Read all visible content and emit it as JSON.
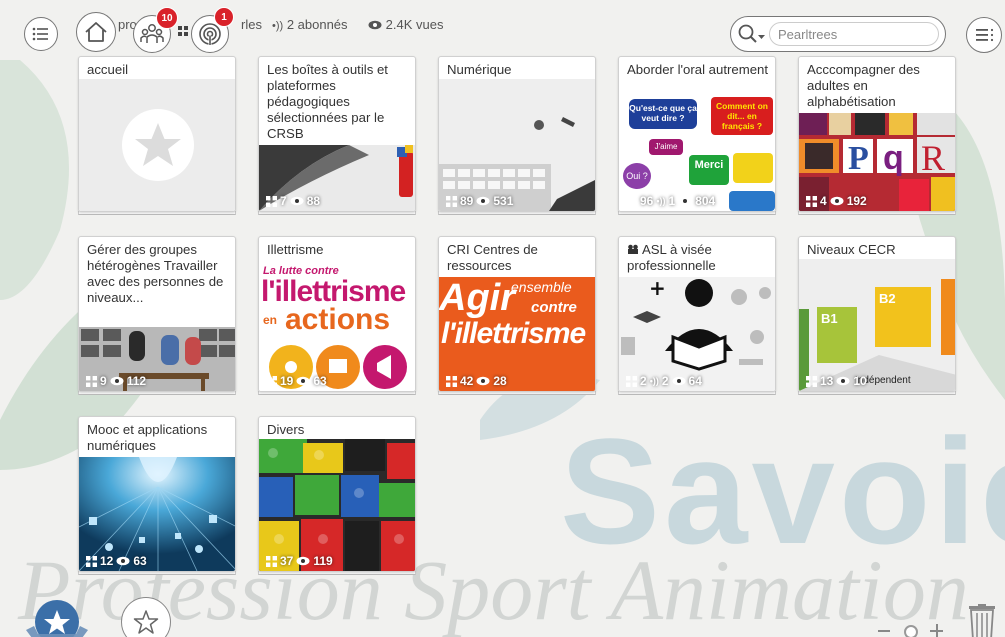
{
  "header": {
    "owner_partial": "pro",
    "pearls_partial": "rles",
    "subscribers": "2 abonnés",
    "views": "2.4K vues",
    "notifications_count": "10",
    "alerts_count": "1"
  },
  "search": {
    "placeholder": "Pearltrees"
  },
  "background": {
    "watermark_text": "Profession Sport Animation",
    "watermark_region": "Savoie"
  },
  "cards": [
    {
      "title": "accueil",
      "pearls": "",
      "views": ""
    },
    {
      "title": "Les boîtes à outils et plateformes pédagogiques sélectionnées par le CRSB",
      "pearls": "7",
      "views": "88"
    },
    {
      "title": "Numérique",
      "pearls": "89",
      "views": "531"
    },
    {
      "title": "Aborder l'oral autrement",
      "pearls": "96",
      "subscribers": "1",
      "views": "804",
      "img_text": [
        "Qu'est-ce que ça veut dire ?",
        "Comment on dit... en français ?",
        "J'aime",
        "Merci",
        "Oui ?"
      ]
    },
    {
      "title": "Acccompagner des adultes en alphabétisation",
      "pearls": "4",
      "views": "192"
    },
    {
      "title": "Gérer des groupes hétérogènes Travailler avec des personnes de niveaux...",
      "pearls": "9",
      "views": "112"
    },
    {
      "title": "Illettrisme",
      "pearls": "19",
      "views": "63",
      "img_text": [
        "La lutte contre",
        "l'illettrisme",
        "en",
        "actions"
      ]
    },
    {
      "title": "CRI Centres de ressources",
      "pearls": "42",
      "views": "28",
      "img_text": [
        "Agir",
        "ensemble",
        "contre",
        "l'illettrisme"
      ]
    },
    {
      "title": "ASL à visée professionnelle",
      "pearls": "2",
      "subscribers": "2",
      "views": "64"
    },
    {
      "title": "Niveaux CECR",
      "pearls": "13",
      "views": "10",
      "img_text": [
        "B1",
        "B2",
        "Indépendent"
      ]
    },
    {
      "title": "Mooc et applications numériques",
      "pearls": "12",
      "views": "63"
    },
    {
      "title": "Divers",
      "pearls": "37",
      "views": "119"
    }
  ],
  "colors": {
    "badge": "#d9222a",
    "accent_blue": "#3b6fa8",
    "card_bg": "#ffffff",
    "background": "#f1f1ef"
  }
}
